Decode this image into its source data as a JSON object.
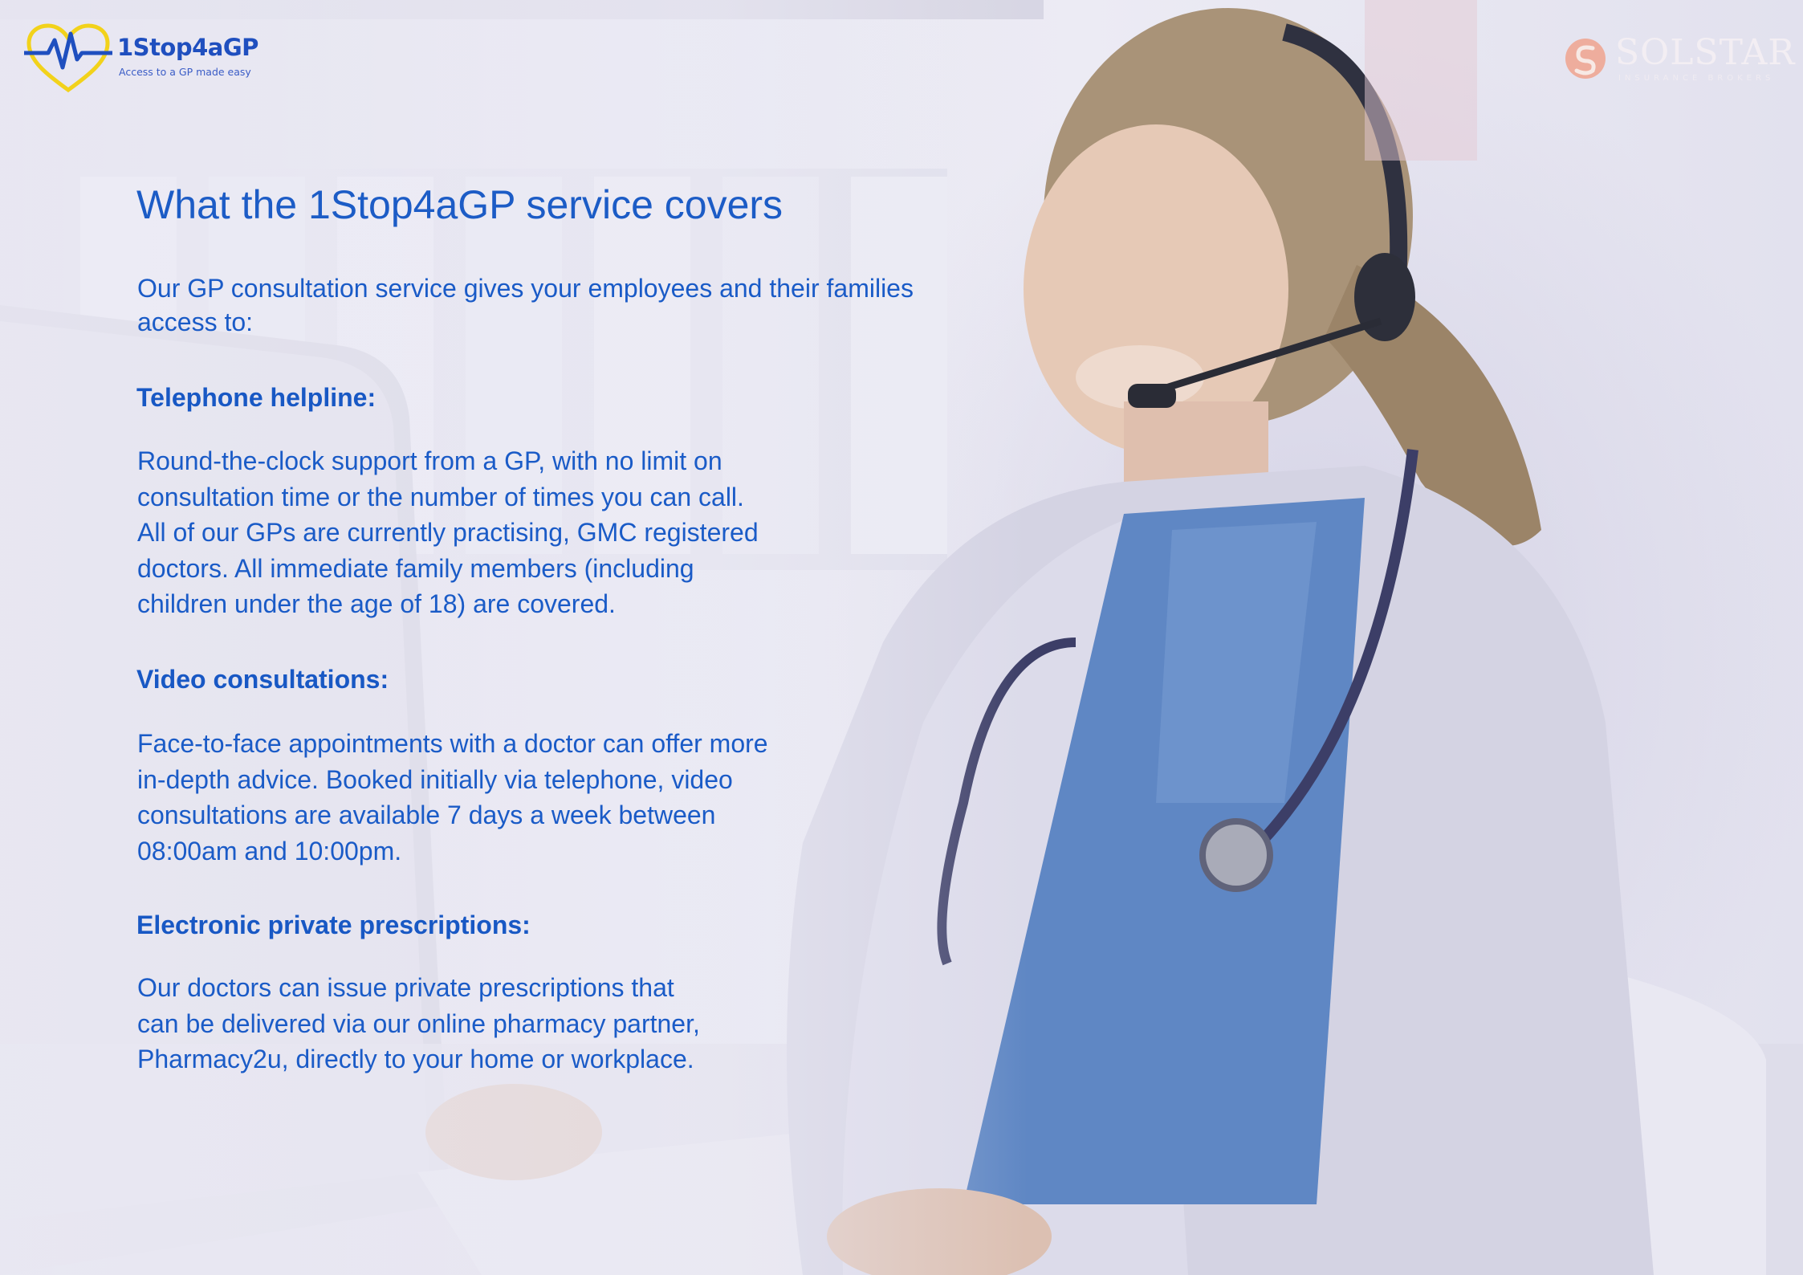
{
  "brand": {
    "name": "1Stop4aGP",
    "tagline": "Access to a GP made easy",
    "partner_name": "SOLSTAR",
    "partner_tagline": "INSURANCE BROKERS"
  },
  "title": "What the 1Stop4aGP service covers",
  "intro": "Our GP consultation service gives your employees and their families\n access to:",
  "sections": [
    {
      "heading": "Telephone helpline:",
      "body": "Round-the-clock support from a GP, with no limit on\nconsultation time or the number of times you can call.\nAll of our GPs are currently practising, GMC registered\ndoctors. All immediate family members (including\nchildren under the age of 18) are covered."
    },
    {
      "heading": "Video consultations:",
      "body": "Face-to-face appointments with a doctor can offer more\nin-depth advice. Booked initially via telephone, video\nconsultations are available 7 days a week between\n08:00am and 10:00pm."
    },
    {
      "heading": "Electronic private prescriptions:",
      "body": "Our doctors can issue private prescriptions that\ncan be delivered via our online pharmacy partner,\nPharmacy2u, directly to your  home or workplace."
    }
  ],
  "colors": {
    "text_blue": "#1a5bc7",
    "logo_blue": "#1f4fbf",
    "logo_yellow": "#f2d21b",
    "partner_peach": "#f0a48f"
  }
}
